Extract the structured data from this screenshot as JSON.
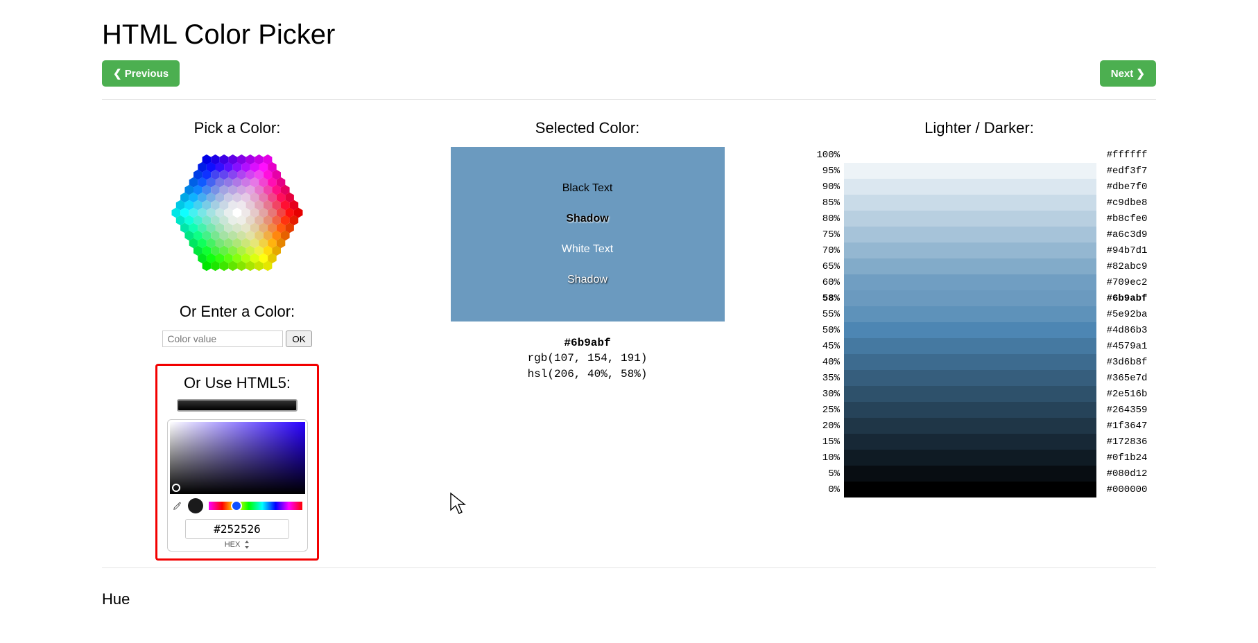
{
  "title": "HTML Color Picker",
  "nav": {
    "prev": "❮ Previous",
    "next": "Next ❯"
  },
  "pick": {
    "heading": "Pick a Color:",
    "enter_heading": "Or Enter a Color:",
    "enter_placeholder": "Color value",
    "enter_ok": "OK",
    "html5_heading": "Or Use HTML5:",
    "html5_hex": "#252526",
    "html5_format": "HEX"
  },
  "selected": {
    "heading": "Selected Color:",
    "bg": "#6b9abf",
    "black_text": "Black Text",
    "shadow_black": "Shadow",
    "white_text": "White Text",
    "shadow_white": "Shadow",
    "hex": "#6b9abf",
    "rgb": "rgb(107, 154, 191)",
    "hsl": "hsl(206, 40%, 58%)"
  },
  "ld": {
    "heading": "Lighter / Darker:",
    "current_pct": "58%",
    "rows": [
      {
        "pct": "100%",
        "hex": "#ffffff",
        "bg": "#ffffff"
      },
      {
        "pct": "95%",
        "hex": "#edf3f7",
        "bg": "#edf3f7"
      },
      {
        "pct": "90%",
        "hex": "#dbe7f0",
        "bg": "#dbe7f0"
      },
      {
        "pct": "85%",
        "hex": "#c9dbe8",
        "bg": "#c9dbe8"
      },
      {
        "pct": "80%",
        "hex": "#b8cfe0",
        "bg": "#b8cfe0"
      },
      {
        "pct": "75%",
        "hex": "#a6c3d9",
        "bg": "#a6c3d9"
      },
      {
        "pct": "70%",
        "hex": "#94b7d1",
        "bg": "#94b7d1"
      },
      {
        "pct": "65%",
        "hex": "#82abc9",
        "bg": "#82abc9"
      },
      {
        "pct": "60%",
        "hex": "#709ec2",
        "bg": "#709ec2"
      },
      {
        "pct": "58%",
        "hex": "#6b9abf",
        "bg": "#6b9abf",
        "current": true
      },
      {
        "pct": "55%",
        "hex": "#5e92ba",
        "bg": "#5e92ba"
      },
      {
        "pct": "50%",
        "hex": "#4d86b3",
        "bg": "#4d86b3"
      },
      {
        "pct": "45%",
        "hex": "#4579a1",
        "bg": "#4579a1"
      },
      {
        "pct": "40%",
        "hex": "#3d6b8f",
        "bg": "#3d6b8f"
      },
      {
        "pct": "35%",
        "hex": "#365e7d",
        "bg": "#365e7d"
      },
      {
        "pct": "30%",
        "hex": "#2e516b",
        "bg": "#2e516b"
      },
      {
        "pct": "25%",
        "hex": "#264359",
        "bg": "#264359"
      },
      {
        "pct": "20%",
        "hex": "#1f3647",
        "bg": "#1f3647"
      },
      {
        "pct": "15%",
        "hex": "#172836",
        "bg": "#172836"
      },
      {
        "pct": "10%",
        "hex": "#0f1b24",
        "bg": "#0f1b24"
      },
      {
        "pct": "5%",
        "hex": "#080d12",
        "bg": "#080d12"
      },
      {
        "pct": "0%",
        "hex": "#000000",
        "bg": "#000000"
      }
    ]
  },
  "footer": {
    "hue_heading": "Hue"
  }
}
